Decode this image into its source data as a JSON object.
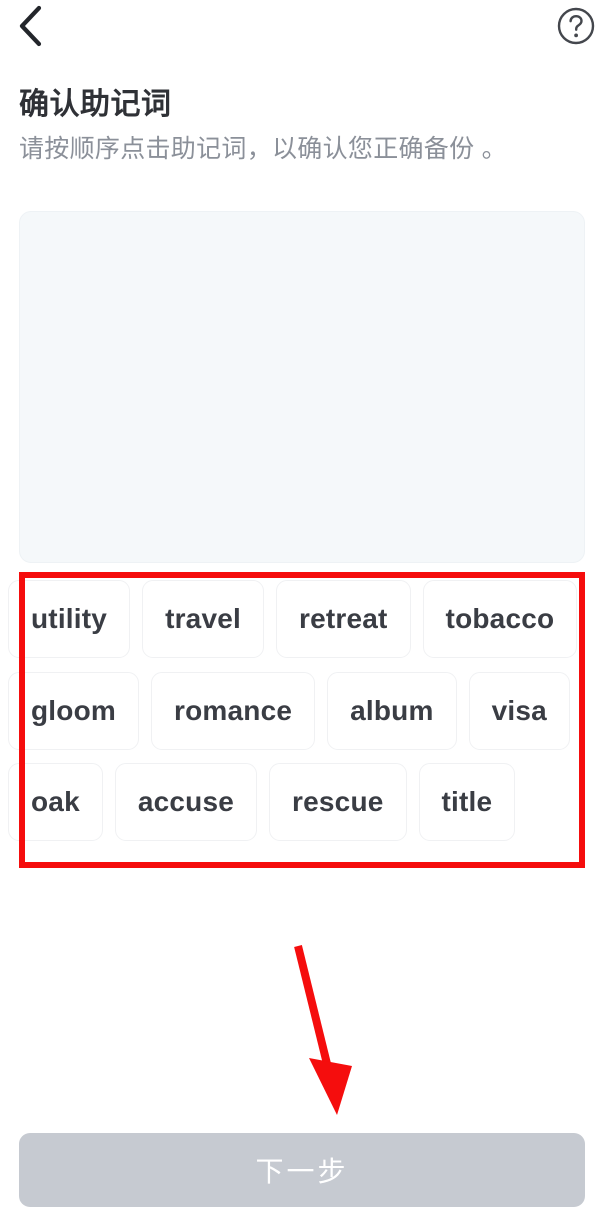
{
  "topbar": {
    "back_icon": "chevron-left-icon",
    "help_icon": "question-circle-icon"
  },
  "header": {
    "title": "确认助记词",
    "subtitle": "请按顺序点击助记词，以确认您正确备份 。"
  },
  "answer_panel": {
    "selected_words": [],
    "background_color": "#f5f8fa"
  },
  "word_bank": {
    "rows": [
      [
        "utility",
        "travel",
        "retreat",
        "tobacco"
      ],
      [
        "gloom",
        "romance",
        "album",
        "visa"
      ],
      [
        "oak",
        "accuse",
        "rescue",
        "title"
      ]
    ],
    "all_words": [
      "utility",
      "travel",
      "retreat",
      "tobacco",
      "gloom",
      "romance",
      "album",
      "visa",
      "oak",
      "accuse",
      "rescue",
      "title"
    ],
    "chip_background": "#ffffff",
    "chip_text_color": "#3a3d44"
  },
  "footer": {
    "next_label": "下一步",
    "next_enabled": false,
    "next_color": "#c6cad1"
  },
  "annotations": {
    "highlight_color": "#f50d0d",
    "box_target": "word-bank",
    "arrow_target": "next-button"
  }
}
